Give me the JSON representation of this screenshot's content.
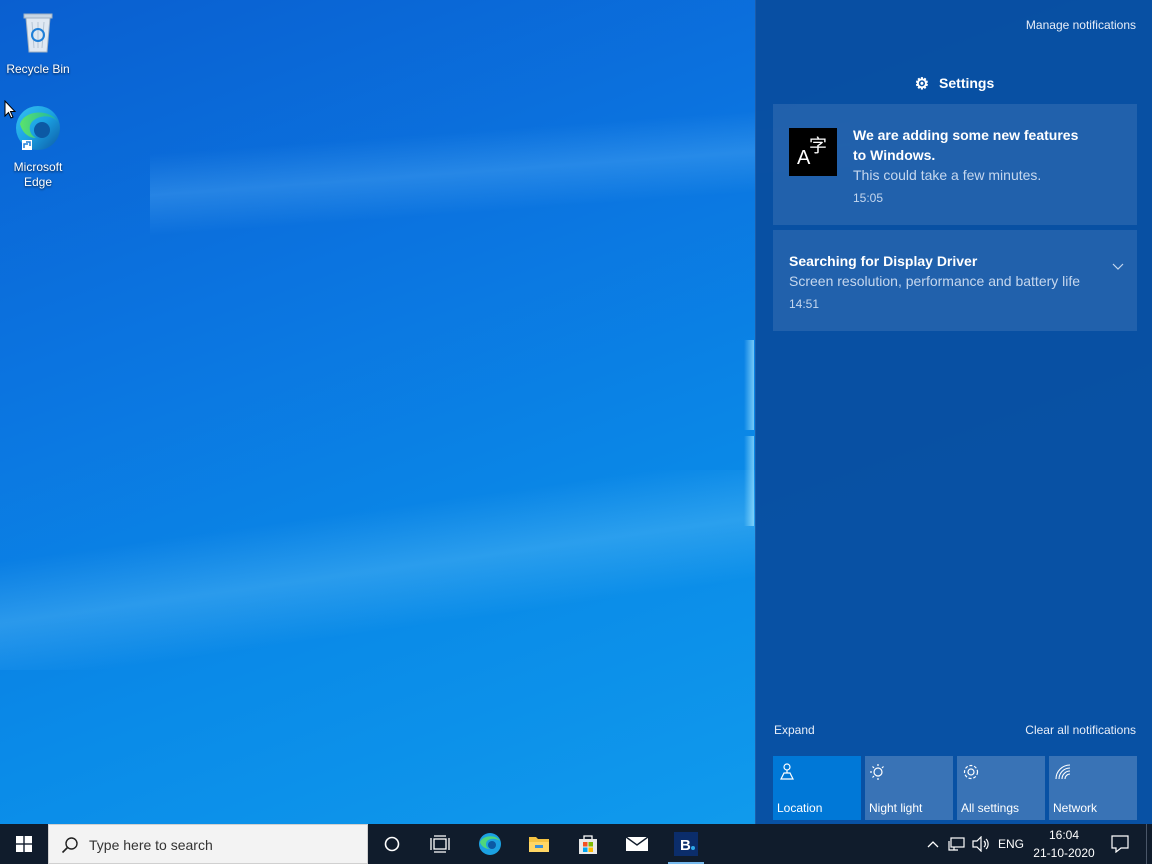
{
  "desktop": {
    "icons": [
      {
        "label": "Recycle Bin"
      },
      {
        "label": "Microsoft Edge"
      }
    ]
  },
  "action_center": {
    "manage_label": "Manage notifications",
    "group_title": "Settings",
    "notifications": [
      {
        "title_line1": "We are adding some new features",
        "title_line2": "to Windows.",
        "body": "This could take a few minutes.",
        "time": "15:05",
        "icon": "language-icon"
      },
      {
        "title": "Searching for Display Driver",
        "body": "Screen resolution, performance and battery life",
        "time": "14:51"
      }
    ],
    "expand_label": "Expand",
    "clear_label": "Clear all notifications",
    "quick_actions": [
      {
        "label": "Location",
        "icon": "location-icon",
        "active": true
      },
      {
        "label": "Night light",
        "icon": "night-light-icon",
        "active": false
      },
      {
        "label": "All settings",
        "icon": "gear-icon",
        "active": false
      },
      {
        "label": "Network",
        "icon": "network-icon",
        "active": false
      }
    ]
  },
  "taskbar": {
    "search_placeholder": "Type here to search",
    "language": "ENG",
    "time": "16:04",
    "date": "21-10-2020",
    "pinned": [
      "cortana-icon",
      "task-view-icon",
      "edge-icon",
      "file-explorer-icon",
      "store-icon",
      "mail-icon",
      "booking-icon"
    ]
  },
  "colors": {
    "accent": "#0078d7",
    "taskbar": "#101c2c",
    "action_center": "#084ea0"
  }
}
